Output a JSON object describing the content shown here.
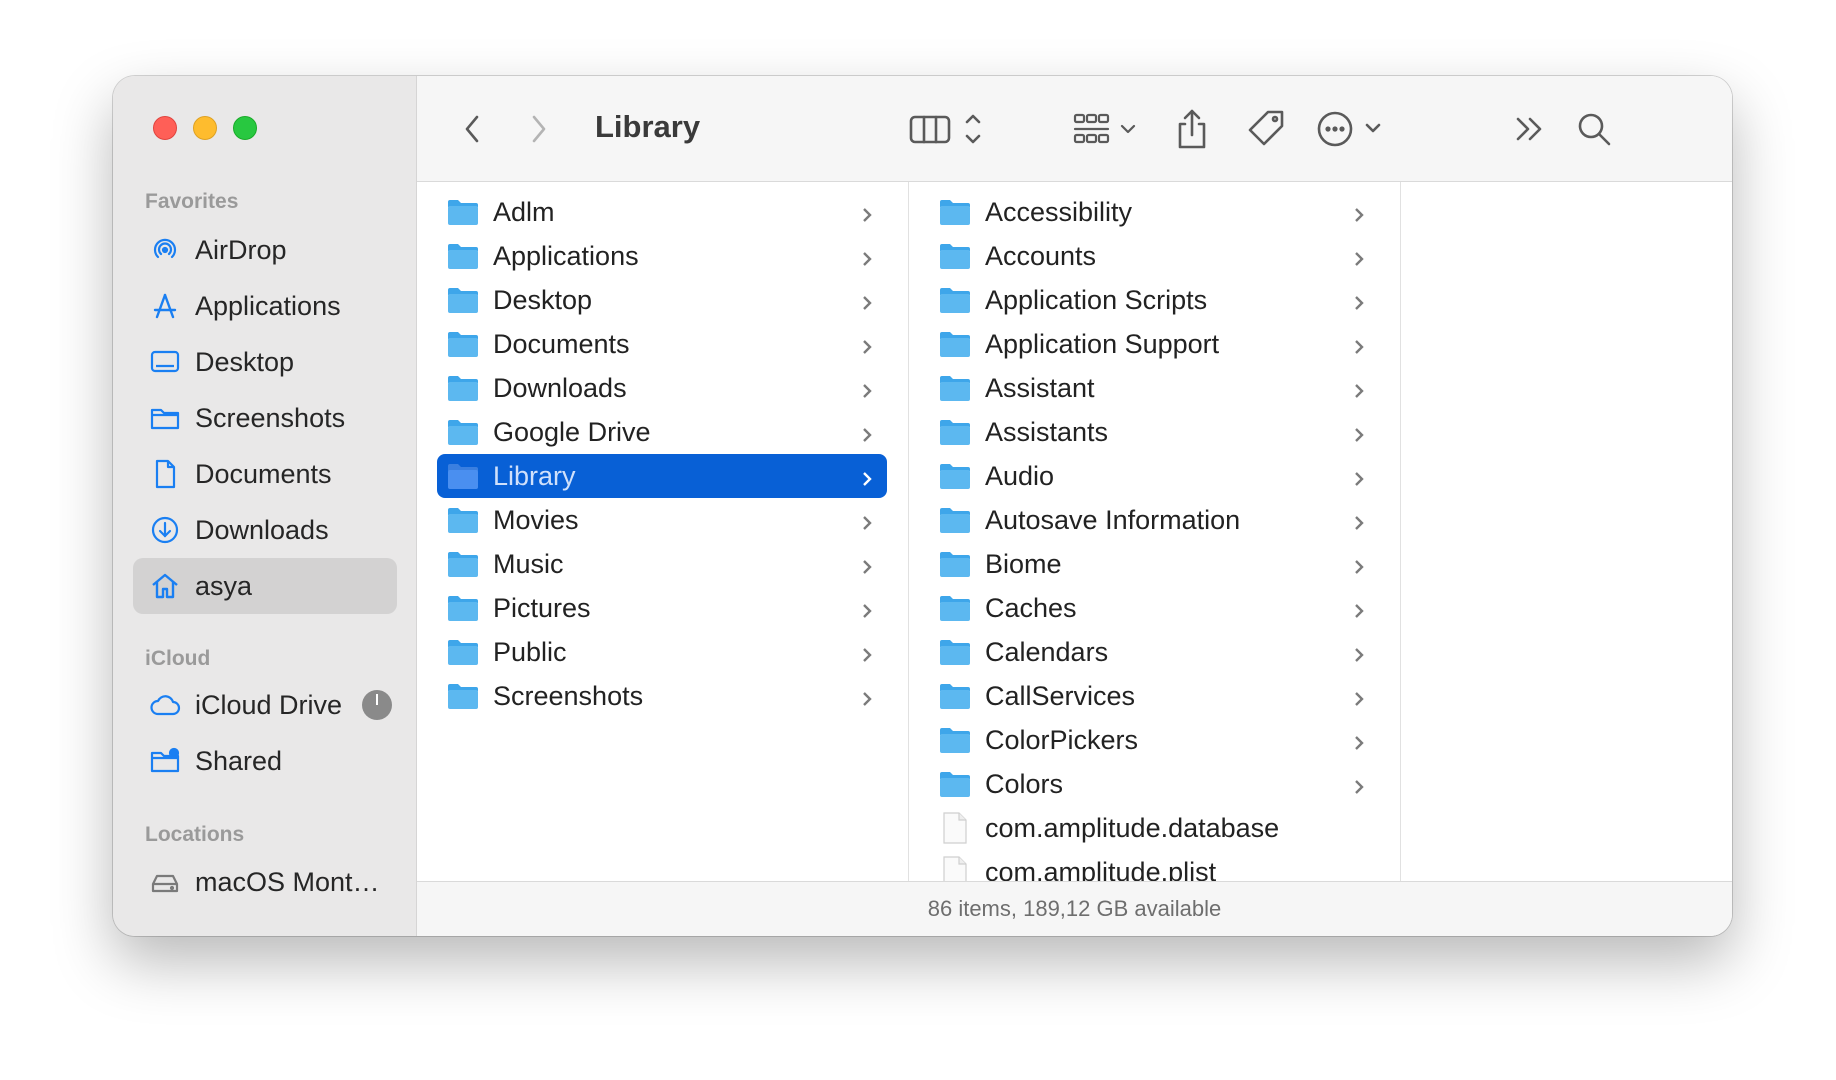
{
  "sidebar": {
    "favorites_title": "Favorites",
    "favorites": [
      {
        "label": "AirDrop",
        "icon": "airdrop-icon"
      },
      {
        "label": "Applications",
        "icon": "applications-icon"
      },
      {
        "label": "Desktop",
        "icon": "desktop-icon"
      },
      {
        "label": "Screenshots",
        "icon": "folder-icon"
      },
      {
        "label": "Documents",
        "icon": "document-icon"
      },
      {
        "label": "Downloads",
        "icon": "download-icon"
      },
      {
        "label": "asya",
        "icon": "home-icon",
        "selected": true
      }
    ],
    "icloud_title": "iCloud",
    "icloud": [
      {
        "label": "iCloud Drive",
        "icon": "cloud-icon"
      },
      {
        "label": "Shared",
        "icon": "shared-folder-icon"
      }
    ],
    "locations_title": "Locations",
    "locations": [
      {
        "label": "macOS Mont…",
        "icon": "disk-icon"
      }
    ]
  },
  "toolbar": {
    "title": "Library",
    "accent": "#0860d6"
  },
  "column1": [
    {
      "label": "Adlm"
    },
    {
      "label": "Applications"
    },
    {
      "label": "Desktop"
    },
    {
      "label": "Documents"
    },
    {
      "label": "Downloads"
    },
    {
      "label": "Google Drive"
    },
    {
      "label": "Library",
      "selected": true
    },
    {
      "label": "Movies"
    },
    {
      "label": "Music"
    },
    {
      "label": "Pictures"
    },
    {
      "label": "Public"
    },
    {
      "label": "Screenshots"
    }
  ],
  "column2": [
    {
      "label": "Accessibility",
      "type": "folder"
    },
    {
      "label": "Accounts",
      "type": "folder"
    },
    {
      "label": "Application Scripts",
      "type": "folder"
    },
    {
      "label": "Application Support",
      "type": "folder"
    },
    {
      "label": "Assistant",
      "type": "folder"
    },
    {
      "label": "Assistants",
      "type": "folder"
    },
    {
      "label": "Audio",
      "type": "folder"
    },
    {
      "label": "Autosave Information",
      "type": "folder"
    },
    {
      "label": "Biome",
      "type": "folder"
    },
    {
      "label": "Caches",
      "type": "folder"
    },
    {
      "label": "Calendars",
      "type": "folder"
    },
    {
      "label": "CallServices",
      "type": "folder"
    },
    {
      "label": "ColorPickers",
      "type": "folder"
    },
    {
      "label": "Colors",
      "type": "folder"
    },
    {
      "label": "com.amplitude.database",
      "type": "file"
    },
    {
      "label": "com.amplitude.plist",
      "type": "file"
    }
  ],
  "status": "86 items, 189,12 GB available"
}
